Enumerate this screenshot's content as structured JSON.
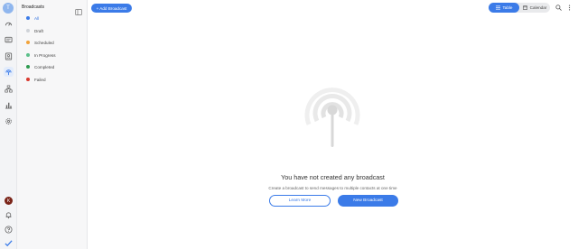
{
  "rail": {
    "avatar_initial": "T",
    "profile_initial": "K",
    "icons": [
      "dashboard-icon",
      "messages-icon",
      "contacts-icon",
      "broadcast-icon",
      "flows-icon",
      "reports-icon",
      "settings-icon",
      "notifications-icon",
      "help-icon",
      "check-icon"
    ]
  },
  "sidebar": {
    "title": "Broadcasts",
    "items": [
      {
        "label": "All",
        "color": "#3b7be8"
      },
      {
        "label": "Draft",
        "color": "#cfd3d8"
      },
      {
        "label": "Scheduled",
        "color": "#f2a33a"
      },
      {
        "label": "In Progress",
        "color": "#5cc08a"
      },
      {
        "label": "Completed",
        "color": "#2e9b4f"
      },
      {
        "label": "Failed",
        "color": "#d93a2f"
      }
    ]
  },
  "toolbar": {
    "add_label": "+ Add Broadcast",
    "view_table": "Table",
    "view_calendar": "Calendar"
  },
  "empty": {
    "title": "You have not created any broadcast",
    "subtitle": "Create a broadcast to send messages to multiple contacts at one time",
    "learn_label": "Learn More",
    "new_label": "New Broadcast"
  },
  "colors": {
    "accent": "#3b7be8",
    "rail_bg": "#f3f4f6",
    "sidebar_bg": "#f7f7f8"
  }
}
